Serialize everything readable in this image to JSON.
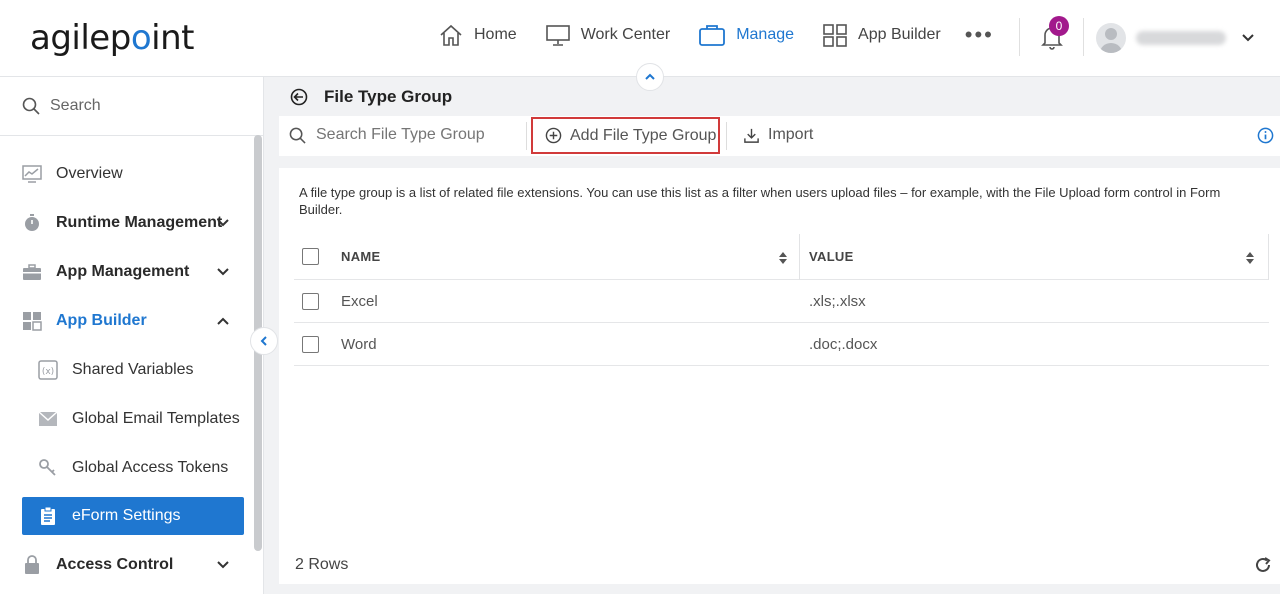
{
  "header": {
    "logo_text_a": "agilep",
    "logo_text_o": "o",
    "logo_text_b": "int",
    "nav": [
      {
        "label": "Home",
        "icon": "home-icon"
      },
      {
        "label": "Work Center",
        "icon": "monitor-icon"
      },
      {
        "label": "Manage",
        "icon": "briefcase-icon",
        "active": true
      },
      {
        "label": "App Builder",
        "icon": "grid-icon"
      }
    ],
    "notification_count": "0",
    "accent_color": "#1f77d0",
    "badge_color": "#a2198c"
  },
  "sidebar": {
    "search_label": "Search",
    "items": [
      {
        "label": "Overview",
        "icon": "chart-icon"
      },
      {
        "label": "Runtime Management",
        "icon": "stopwatch-icon"
      },
      {
        "label": "App Management",
        "icon": "toolbox-icon"
      },
      {
        "label": "App Builder",
        "icon": "app-grid-icon"
      },
      {
        "label": "Shared Variables",
        "icon": "variable-icon"
      },
      {
        "label": "Global Email Templates",
        "icon": "envelope-icon"
      },
      {
        "label": "Global Access Tokens",
        "icon": "keys-icon"
      },
      {
        "label": "eForm Settings",
        "icon": "clipboard-icon"
      },
      {
        "label": "Access Control",
        "icon": "lock-icon"
      }
    ]
  },
  "page": {
    "title": "File Type Group",
    "search_placeholder": "Search File Type Group",
    "add_label": "Add File Type Group",
    "import_label": "Import",
    "description": "A file type group is a list of related file extensions. You can use this list as a filter when users upload files – for example, with the File Upload form control in Form Builder."
  },
  "table": {
    "columns": [
      "NAME",
      "VALUE"
    ],
    "rows": [
      {
        "name": "Excel",
        "value": ".xls;.xlsx"
      },
      {
        "name": "Word",
        "value": ".doc;.docx"
      }
    ],
    "row_count": "2 Rows"
  }
}
